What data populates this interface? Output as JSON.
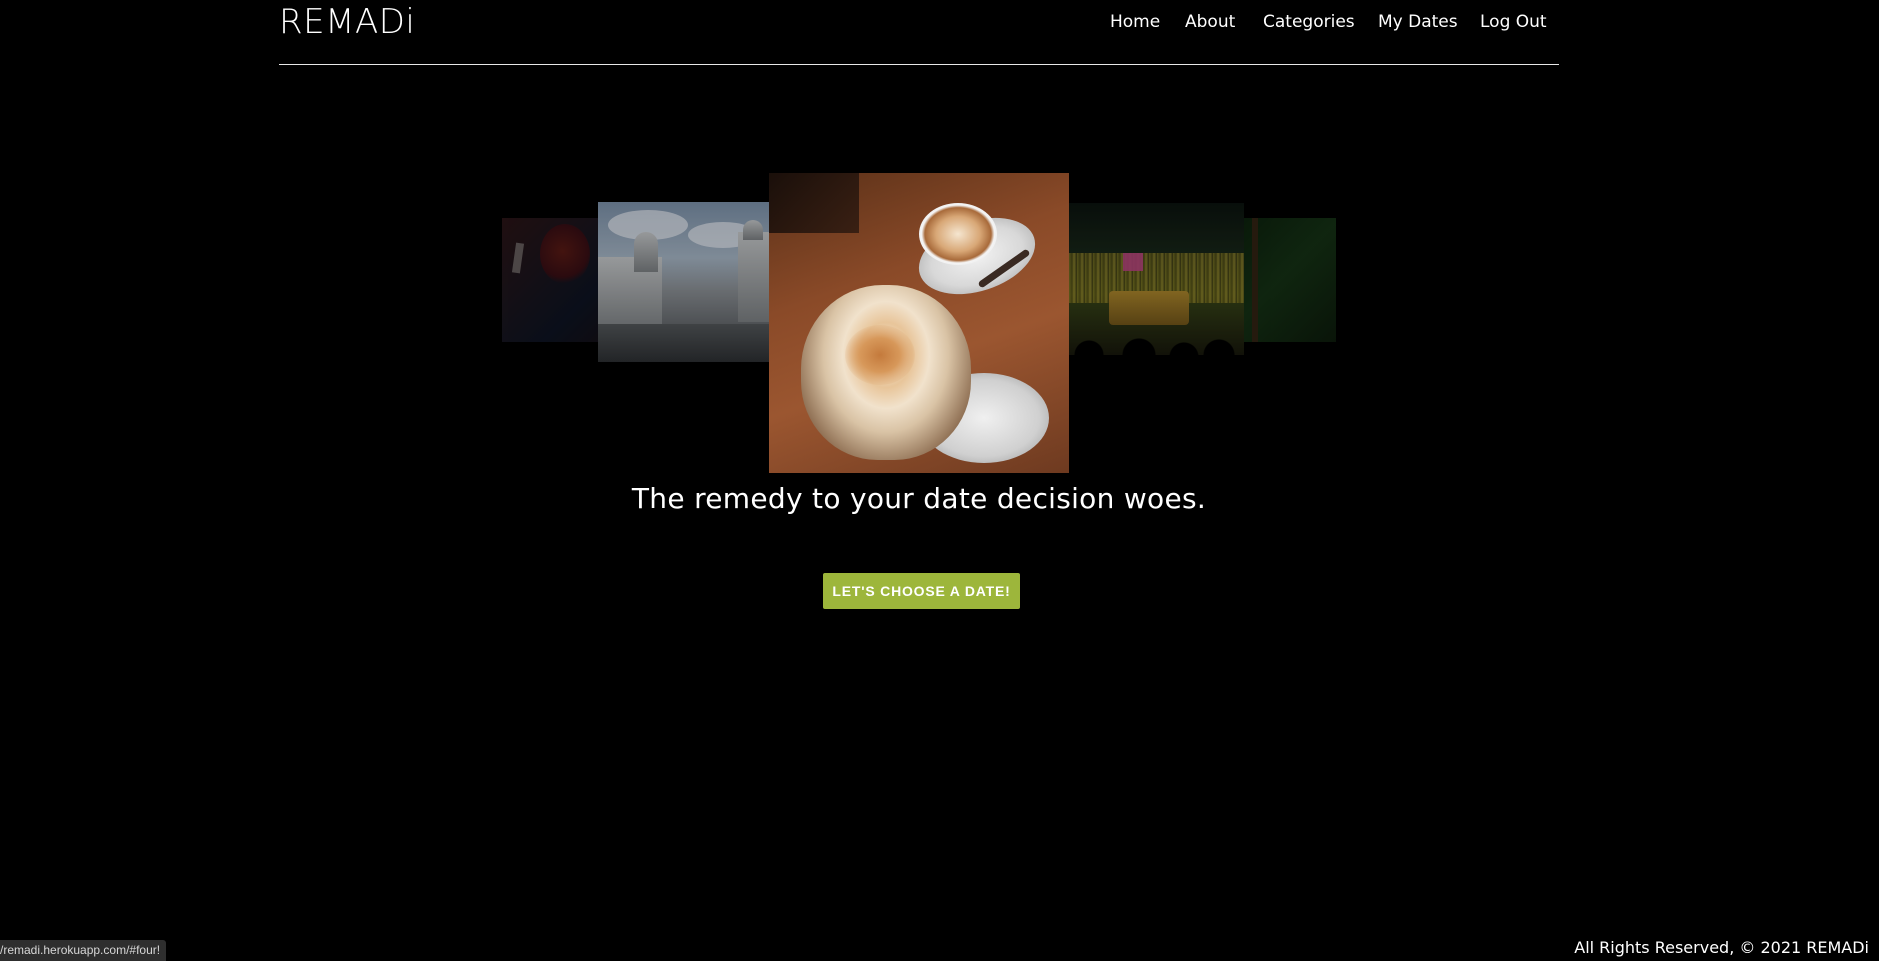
{
  "header": {
    "logo": "REMADi",
    "nav": [
      {
        "label": "Home"
      },
      {
        "label": "About"
      },
      {
        "label": "Categories"
      },
      {
        "label": "My Dates"
      },
      {
        "label": "Log Out"
      }
    ]
  },
  "hero": {
    "slides": [
      {
        "subject": "red sign"
      },
      {
        "subject": "cemetery tombs under cloudy sky"
      },
      {
        "subject": "coffee and latte art"
      },
      {
        "subject": "basketball arena crowd"
      },
      {
        "subject": "green outdoor scene"
      }
    ],
    "tagline": "The remedy to your date decision woes.",
    "cta_label": "LET'S CHOOSE A DATE!",
    "cta_color": "#9db63b"
  },
  "footer": {
    "copyright": "All Rights Reserved, © 2021 REMADi"
  },
  "status_bar": {
    "url": "/remadi.herokuapp.com/#four!"
  },
  "colors": {
    "background": "#000000",
    "text": "#ffffff"
  }
}
